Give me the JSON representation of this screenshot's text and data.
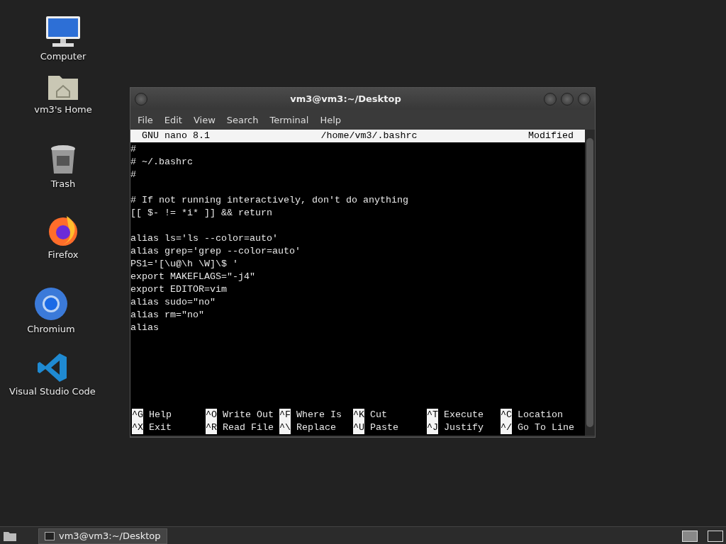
{
  "desktop_icons": [
    {
      "kind": "computer",
      "label": "Computer"
    },
    {
      "kind": "home",
      "label": "vm3's Home"
    },
    {
      "kind": "trash",
      "label": "Trash"
    },
    {
      "kind": "firefox",
      "label": "Firefox"
    },
    {
      "kind": "chromium",
      "label": "Chromium"
    },
    {
      "kind": "vscode",
      "label": "Visual Studio Code"
    }
  ],
  "window": {
    "title": "vm3@vm3:~/Desktop",
    "menu": [
      "File",
      "Edit",
      "View",
      "Search",
      "Terminal",
      "Help"
    ],
    "nano": {
      "version": "GNU nano 8.1",
      "file": "/home/vm3/.bashrc",
      "status": "Modified",
      "blocks": [
        [
          "#",
          "# ~/.bashrc",
          "#"
        ],
        [
          "# If not running interactively, don't do anything",
          "[[ $- != *i* ]] && return"
        ],
        [
          "alias ls='ls --color=auto'",
          "alias grep='grep --color=auto'",
          "PS1='[\\u@\\h \\W]\\$ '",
          "export MAKEFLAGS=\"-j4\"",
          "export EDITOR=vim",
          "alias sudo=\"no\"",
          "alias rm=\"no\"",
          "alias"
        ]
      ],
      "shortcuts": [
        [
          {
            "key": "^G",
            "label": "Help"
          },
          {
            "key": "^O",
            "label": "Write Out"
          },
          {
            "key": "^F",
            "label": "Where Is"
          },
          {
            "key": "^K",
            "label": "Cut"
          },
          {
            "key": "^T",
            "label": "Execute"
          },
          {
            "key": "^C",
            "label": "Location"
          }
        ],
        [
          {
            "key": "^X",
            "label": "Exit"
          },
          {
            "key": "^R",
            "label": "Read File"
          },
          {
            "key": "^\\",
            "label": "Replace"
          },
          {
            "key": "^U",
            "label": "Paste"
          },
          {
            "key": "^J",
            "label": "Justify"
          },
          {
            "key": "^/",
            "label": "Go To Line"
          }
        ]
      ]
    }
  },
  "taskbar": {
    "tasks": [
      {
        "label": "vm3@vm3:~/Desktop"
      }
    ],
    "workspaces": [
      {
        "selected": true
      },
      {
        "selected": false
      }
    ]
  }
}
